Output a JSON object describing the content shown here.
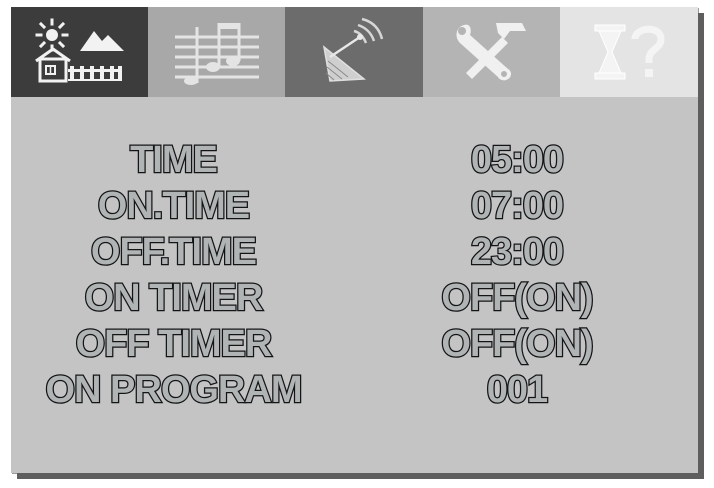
{
  "tabs": [
    {
      "id": "home",
      "icon": "house-sun-icon",
      "bg": "#3c3c3c"
    },
    {
      "id": "music",
      "icon": "music-notes-icon",
      "bg": "#a8a8a8"
    },
    {
      "id": "antenna",
      "icon": "satellite-dish-icon",
      "bg": "#6c6c6c"
    },
    {
      "id": "tools",
      "icon": "tools-icon",
      "bg": "#b4b4b4"
    },
    {
      "id": "help",
      "icon": "hourglass-help-icon",
      "bg": "#e4e4e4"
    }
  ],
  "settings": {
    "rows": [
      {
        "label": "TIME",
        "value": "05:00"
      },
      {
        "label": "ON.TIME",
        "value": "07:00"
      },
      {
        "label": "OFF.TIME",
        "value": "23:00"
      },
      {
        "label": "ON TIMER",
        "value": "OFF(ON)"
      },
      {
        "label": "OFF TIMER",
        "value": "OFF(ON)"
      },
      {
        "label": "ON PROGRAM",
        "value": "001"
      }
    ]
  },
  "colors": {
    "screen_bg": "#c4c4c4",
    "text_fill": "#b0b4b4",
    "text_outline": "#141414"
  }
}
